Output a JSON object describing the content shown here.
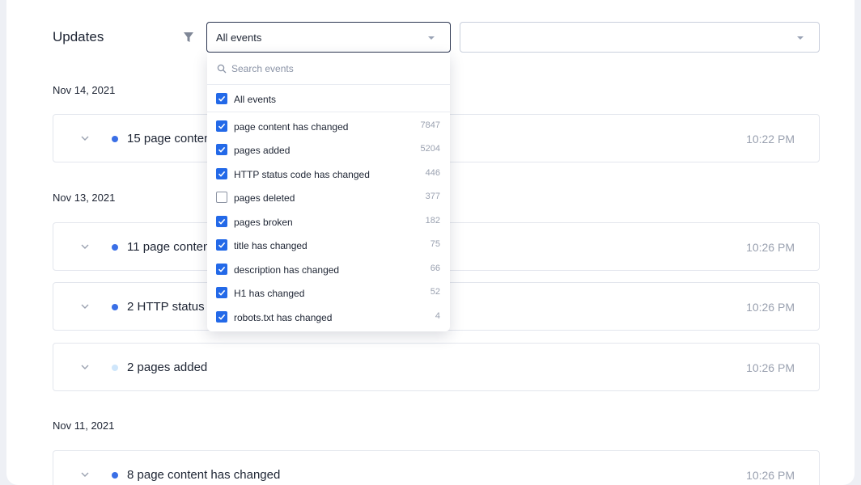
{
  "header": {
    "title": "Updates",
    "event_select_value": "All events",
    "second_select_value": ""
  },
  "dropdown": {
    "search_placeholder": "Search events",
    "all_label": "All events",
    "all_checked": true,
    "options": [
      {
        "label": "page content has changed",
        "count": "7847",
        "checked": true
      },
      {
        "label": "pages added",
        "count": "5204",
        "checked": true
      },
      {
        "label": "HTTP status code has changed",
        "count": "446",
        "checked": true
      },
      {
        "label": "pages deleted",
        "count": "377",
        "checked": false
      },
      {
        "label": "pages broken",
        "count": "182",
        "checked": true
      },
      {
        "label": "title has changed",
        "count": "75",
        "checked": true
      },
      {
        "label": "description has changed",
        "count": "66",
        "checked": true
      },
      {
        "label": "H1 has changed",
        "count": "52",
        "checked": true
      },
      {
        "label": "robots.txt has changed",
        "count": "4",
        "checked": true
      }
    ]
  },
  "groups": [
    {
      "date": "Nov 14, 2021",
      "items": [
        {
          "label": "15 page content has changed",
          "time": "10:22 PM",
          "dot_color": "#3a6fe6"
        }
      ]
    },
    {
      "date": "Nov 13, 2021",
      "items": [
        {
          "label": "11 page content has changed",
          "time": "10:26 PM",
          "dot_color": "#3a6fe6"
        },
        {
          "label": "2 HTTP status code has changed",
          "time": "10:26 PM",
          "dot_color": "#3a6fe6"
        },
        {
          "label": "2 pages added",
          "time": "10:26 PM",
          "dot_color": "#cfe6fb"
        }
      ]
    },
    {
      "date": "Nov 11, 2021",
      "items": [
        {
          "label": "8 page content has changed",
          "time": "10:26 PM",
          "dot_color": "#3a6fe6"
        }
      ]
    }
  ],
  "colors": {
    "accent": "#2369e8",
    "dot_primary": "#3a6fe6",
    "dot_light": "#cfe6fb",
    "muted_text": "#9aa1b0"
  },
  "icons": {
    "filter": "filter-icon",
    "caret": "caret-down-icon",
    "chevron": "chevron-down-icon",
    "search": "search-icon",
    "check": "checkmark-icon"
  }
}
